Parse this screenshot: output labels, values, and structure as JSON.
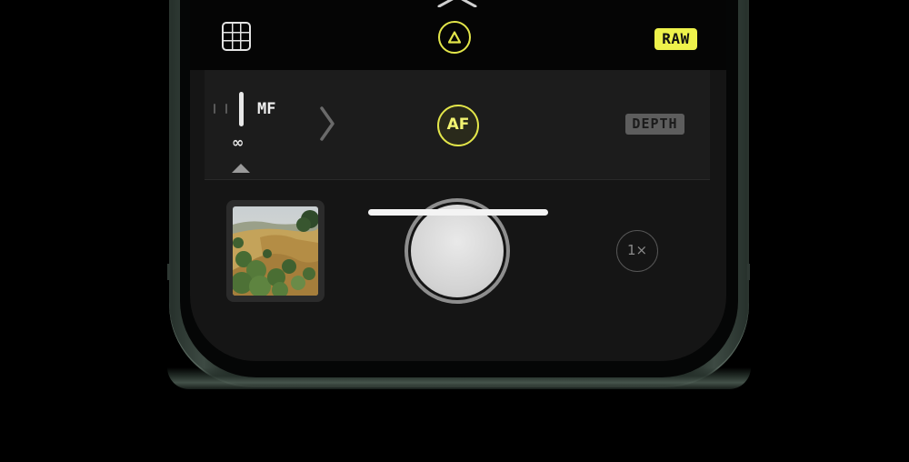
{
  "topbar": {
    "grid_icon": "grid-icon",
    "exposure_icon": "exposure-triangle-icon",
    "chevron_icon": "chevron-up-icon",
    "raw_label": "RAW",
    "accent_color": "#e3e64a"
  },
  "controls": {
    "focus_mode_label": "MF",
    "focus_distance_label": "∞",
    "af_label": "AF",
    "depth_label": "DEPTH",
    "expand_icon": "chevron-right-icon"
  },
  "capture": {
    "thumbnail_icon": "last-photo-thumbnail",
    "shutter_icon": "shutter-button",
    "zoom_label": "1×"
  }
}
